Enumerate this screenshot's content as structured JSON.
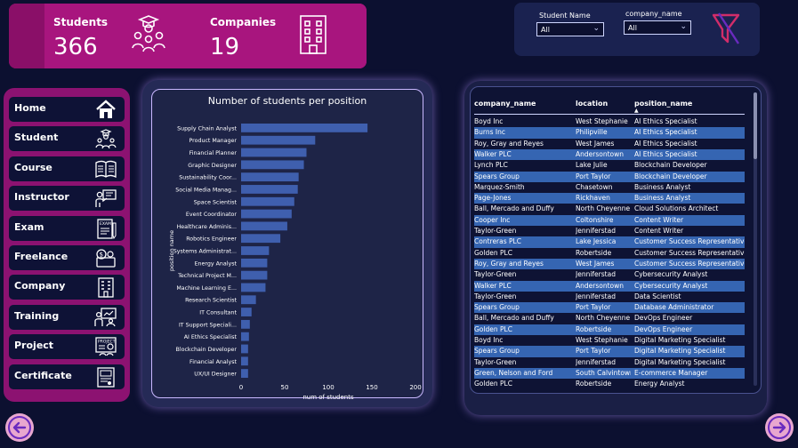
{
  "kpi": {
    "students_label": "Students",
    "students_value": "366",
    "companies_label": "Companies",
    "companies_value": "19"
  },
  "filters": {
    "student_name_label": "Student Name",
    "student_name_value": "All",
    "company_name_label": "company_name",
    "company_name_value": "All"
  },
  "nav": {
    "items": [
      {
        "label": "Home",
        "icon": "home-icon"
      },
      {
        "label": "Student",
        "icon": "students-icon"
      },
      {
        "label": "Course",
        "icon": "book-icon"
      },
      {
        "label": "Instructor",
        "icon": "instructor-icon"
      },
      {
        "label": "Exam",
        "icon": "exam-icon"
      },
      {
        "label": "Freelance",
        "icon": "freelance-icon"
      },
      {
        "label": "Company",
        "icon": "company-icon"
      },
      {
        "label": "Training",
        "icon": "training-icon"
      },
      {
        "label": "Project",
        "icon": "project-icon"
      },
      {
        "label": "Certificate",
        "icon": "certificate-icon"
      }
    ]
  },
  "colors": {
    "accent": "#a8157e",
    "bar": "#3f5fae",
    "row_alt": "#3565b2"
  },
  "chart_data": {
    "type": "bar",
    "orientation": "horizontal",
    "title": "Number of students per position",
    "xlabel": "num of students",
    "ylabel": "position name",
    "xlim": [
      0,
      200
    ],
    "xticks": [
      "0",
      "50",
      "100",
      "150",
      "200"
    ],
    "categories": [
      "Supply Chain Analyst",
      "Product Manager",
      "Financial Planner",
      "Graphic Designer",
      "Sustainability Coor...",
      "Social Media Manag...",
      "Space Scientist",
      "Event Coordinator",
      "Healthcare Adminis...",
      "Robotics Engineer",
      "Systems Administrat...",
      "Energy Analyst",
      "Technical Project M...",
      "Machine Learning E...",
      "Research Scientist",
      "IT Consultant",
      "IT Support Speciali...",
      "AI Ethics Specialist",
      "Blockchain Developer",
      "Financial Analyst",
      "UX/UI Designer"
    ],
    "values": [
      145,
      85,
      75,
      72,
      66,
      65,
      61,
      58,
      53,
      45,
      32,
      30,
      30,
      28,
      17,
      12,
      10,
      9,
      8,
      8,
      8
    ]
  },
  "table": {
    "columns": [
      "company_name",
      "location",
      "position_name"
    ],
    "sort_indicator": "▲",
    "rows": [
      [
        "Boyd Inc",
        "West Stephanie",
        "AI Ethics Specialist"
      ],
      [
        "Burns Inc",
        "Philipville",
        "AI Ethics Specialist"
      ],
      [
        "Roy, Gray and Reyes",
        "West James",
        "AI Ethics Specialist"
      ],
      [
        "Walker PLC",
        "Andersontown",
        "AI Ethics Specialist"
      ],
      [
        "Lynch PLC",
        "Lake Julie",
        "Blockchain Developer"
      ],
      [
        "Spears Group",
        "Port Taylor",
        "Blockchain Developer"
      ],
      [
        "Marquez-Smith",
        "Chasetown",
        "Business Analyst"
      ],
      [
        "Page-Jones",
        "Rickhaven",
        "Business Analyst"
      ],
      [
        "Ball, Mercado and Duffy",
        "North Cheyenne",
        "Cloud Solutions Architect"
      ],
      [
        "Cooper Inc",
        "Coltonshire",
        "Content Writer"
      ],
      [
        "Taylor-Green",
        "Jenniferstad",
        "Content Writer"
      ],
      [
        "Contreras PLC",
        "Lake Jessica",
        "Customer Success Representative"
      ],
      [
        "Golden PLC",
        "Robertside",
        "Customer Success Representative"
      ],
      [
        "Roy, Gray and Reyes",
        "West James",
        "Customer Success Representative"
      ],
      [
        "Taylor-Green",
        "Jenniferstad",
        "Cybersecurity Analyst"
      ],
      [
        "Walker PLC",
        "Andersontown",
        "Cybersecurity Analyst"
      ],
      [
        "Taylor-Green",
        "Jenniferstad",
        "Data Scientist"
      ],
      [
        "Spears Group",
        "Port Taylor",
        "Database Administrator"
      ],
      [
        "Ball, Mercado and Duffy",
        "North Cheyenne",
        "DevOps Engineer"
      ],
      [
        "Golden PLC",
        "Robertside",
        "DevOps Engineer"
      ],
      [
        "Boyd Inc",
        "West Stephanie",
        "Digital Marketing Specialist"
      ],
      [
        "Spears Group",
        "Port Taylor",
        "Digital Marketing Specialist"
      ],
      [
        "Taylor-Green",
        "Jenniferstad",
        "Digital Marketing Specialist"
      ],
      [
        "Green, Nelson and Ford",
        "South Calvintown",
        "E-commerce Manager"
      ],
      [
        "Golden PLC",
        "Robertside",
        "Energy Analyst"
      ]
    ]
  },
  "nav_buttons": {
    "back_icon": "arrow-left-icon",
    "forward_icon": "arrow-right-icon"
  }
}
